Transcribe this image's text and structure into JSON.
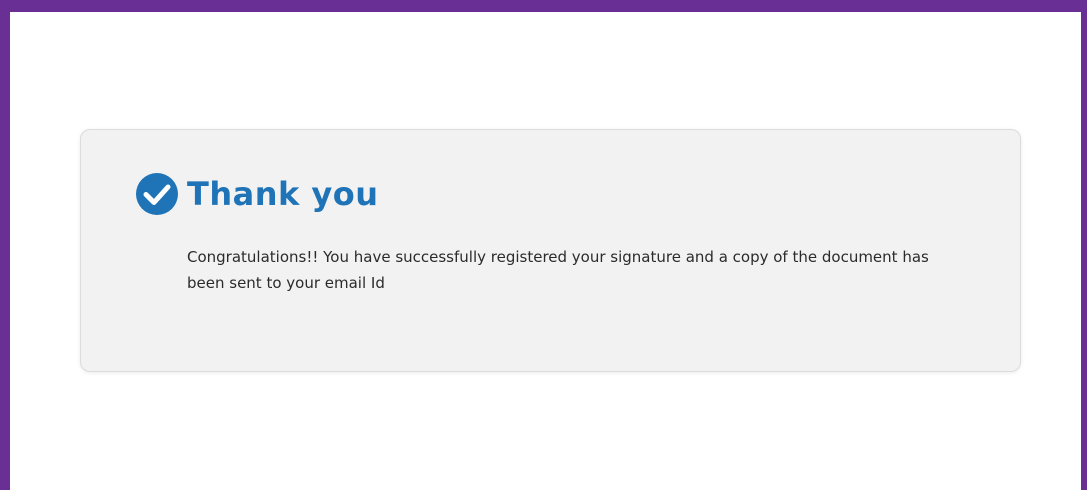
{
  "colors": {
    "frame_border": "#6a2f94",
    "accent": "#1f73b7",
    "card_background": "#f2f2f2",
    "text": "#2b2b2b"
  },
  "confirmation": {
    "icon": "check-circle-icon",
    "title": "Thank you",
    "message": "Congratulations!! You have successfully registered your signature and a copy of the document has been sent to your email Id"
  }
}
